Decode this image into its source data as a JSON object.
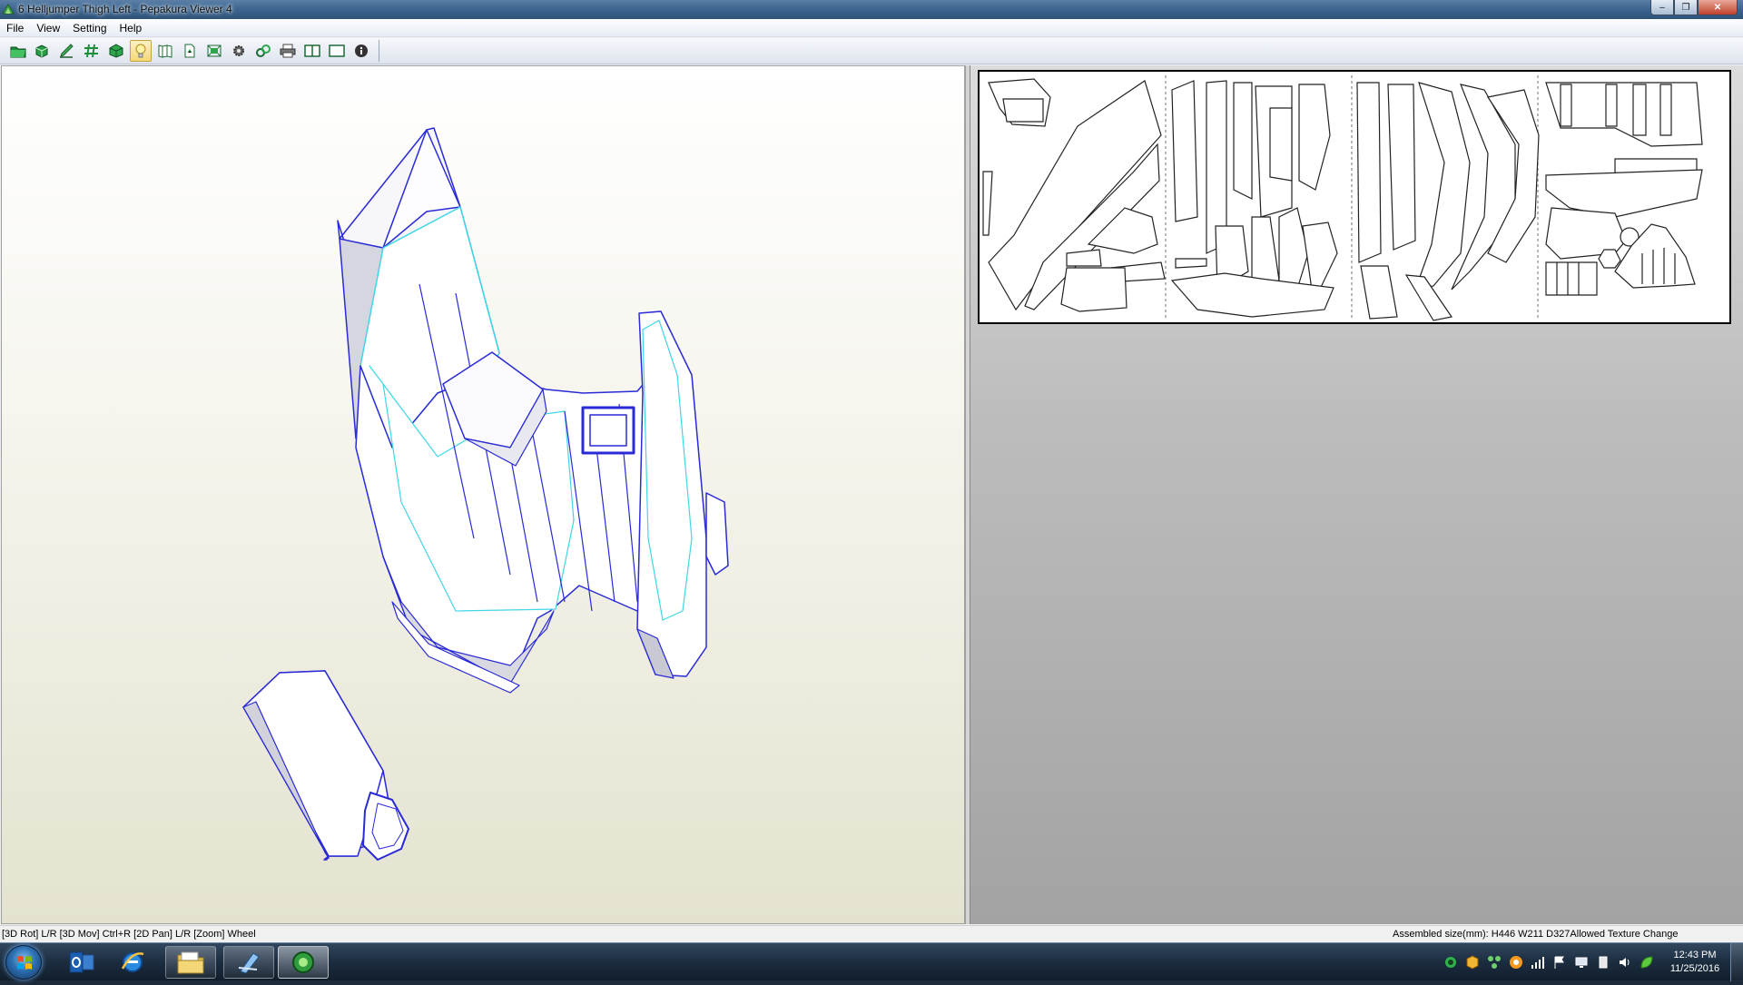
{
  "window": {
    "title": "6 Helljumper Thigh Left - Pepakura Viewer 4",
    "buttons": {
      "minimize": "‒",
      "maximize": "❐",
      "close": "✕"
    }
  },
  "menu": {
    "items": [
      "File",
      "View",
      "Setting",
      "Help"
    ]
  },
  "toolbar": {
    "tools": [
      {
        "icon": "open-folder-icon",
        "active": false
      },
      {
        "icon": "open-3d-icon",
        "active": false
      },
      {
        "icon": "edit-icon",
        "active": false
      },
      {
        "icon": "grid-icon",
        "active": false
      },
      {
        "icon": "cube-icon",
        "active": false
      },
      {
        "icon": "light-icon",
        "active": true
      },
      {
        "icon": "unfold-icon",
        "active": false
      },
      {
        "icon": "page-icon",
        "active": false
      },
      {
        "icon": "fit-view-icon",
        "active": false
      },
      {
        "icon": "settings-gear-icon",
        "active": false
      },
      {
        "icon": "link-icon",
        "active": false
      },
      {
        "icon": "print-icon",
        "active": false
      },
      {
        "icon": "split-view-icon",
        "active": false
      },
      {
        "icon": "single-view-icon",
        "active": false
      },
      {
        "icon": "info-icon",
        "active": false
      }
    ]
  },
  "colors": {
    "edge_blue": "#2a2ad6",
    "edge_cyan": "#3fd6e6",
    "face_white": "#ffffff",
    "face_shade": "#c9c9d3"
  },
  "status": {
    "left": "[3D Rot] L/R [3D Mov] Ctrl+R [2D Pan] L/R [Zoom] Wheel",
    "right": "Assembled size(mm): H446 W211 D327Allowed Texture Change"
  },
  "taskbar": {
    "buttons": [
      {
        "name": "outlook",
        "icon": "outlook-icon"
      },
      {
        "name": "internet-explorer",
        "icon": "ie-icon"
      },
      {
        "name": "file-explorer",
        "icon": "folder-icon"
      },
      {
        "name": "pepakura-designer",
        "icon": "pepakura-designer-icon"
      },
      {
        "name": "pepakura-viewer",
        "icon": "pepakura-viewer-icon"
      }
    ],
    "clock": {
      "time": "12:43 PM",
      "date": "11/25/2016"
    }
  }
}
